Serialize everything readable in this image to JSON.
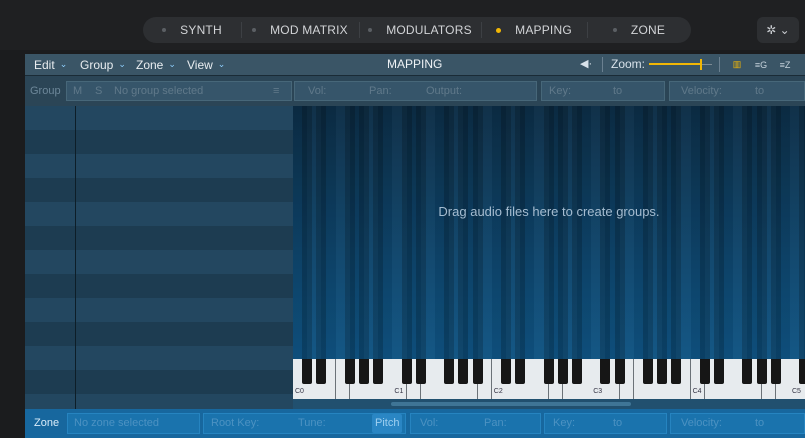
{
  "tabs": [
    {
      "label": "SYNTH",
      "active": false
    },
    {
      "label": "MOD MATRIX",
      "active": false
    },
    {
      "label": "MODULATORS",
      "active": false
    },
    {
      "label": "MAPPING",
      "active": true
    },
    {
      "label": "ZONE",
      "active": false
    }
  ],
  "settings": {
    "icon": "gear-icon",
    "glyph": "✲ ⌄"
  },
  "menubar": {
    "edit": "Edit",
    "group": "Group",
    "zone": "Zone",
    "view": "View",
    "chevron": "⌄",
    "title": "MAPPING",
    "speaker_glyph": "◀·",
    "zoom_label": "Zoom:",
    "zoom_level": 0.83,
    "views": [
      {
        "name": "keyboard-view-icon",
        "glyph": "▥",
        "active": true
      },
      {
        "name": "group-list-view-icon",
        "glyph": "≡G",
        "active": false
      },
      {
        "name": "zone-list-view-icon",
        "glyph": "≡Z",
        "active": false
      }
    ]
  },
  "group_row": {
    "label": "Group",
    "mute": "M",
    "solo": "S",
    "name_placeholder": "No group selected",
    "list_glyph": "≡",
    "vol": "Vol:",
    "pan": "Pan:",
    "output": "Output:",
    "key": "Key:",
    "key_to": "to",
    "velocity": "Velocity:",
    "velocity_to": "to"
  },
  "mapping": {
    "drop_hint": "Drag audio files here to create groups.",
    "octaves": [
      "C0",
      "C1",
      "C2",
      "C3",
      "C4",
      "C5"
    ]
  },
  "zone_row": {
    "label": "Zone",
    "name_placeholder": "No zone selected",
    "root_key": "Root Key:",
    "tune": "Tune:",
    "pitch": "Pitch",
    "vol": "Vol:",
    "pan": "Pan:",
    "key": "Key:",
    "key_to": "to",
    "velocity": "Velocity:",
    "velocity_to": "to"
  },
  "colors": {
    "accent": "#f2b705",
    "menubar": "#3a5566",
    "zone_row": "#17679e"
  }
}
